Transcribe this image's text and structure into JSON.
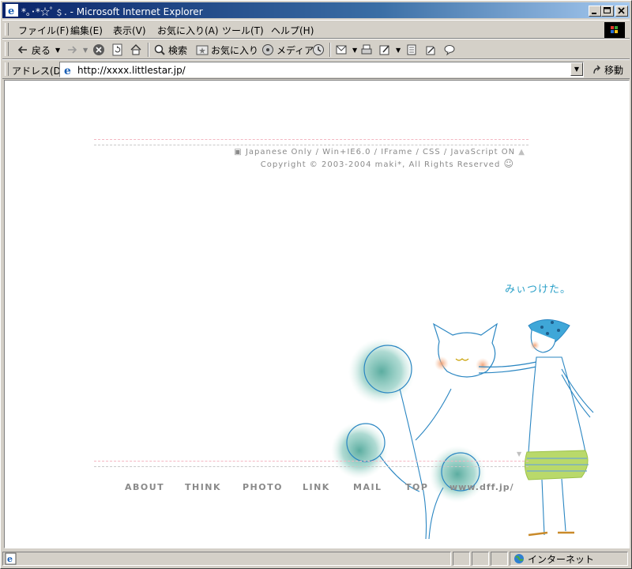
{
  "window": {
    "title": "*｡･*☆ﾟ﹩. - Microsoft Internet Explorer"
  },
  "menu": [
    "ファイル(F)",
    "編集(E)",
    "表示(V)",
    "お気に入り(A)",
    "ツール(T)",
    "ヘルプ(H)"
  ],
  "toolbar": {
    "back": "戻る",
    "search": "検索",
    "favorites": "お気に入り",
    "media": "メディア"
  },
  "address": {
    "label": "アドレス(D)",
    "url": "http://xxxx.littlestar.jp/",
    "go": "移動"
  },
  "page": {
    "info_line": "Japanese Only / Win+IE6.0 / IFrame / CSS / JavaScript ON",
    "copyright": "Copyright © 2003-2004 maki*, All Rights Reserved",
    "handwriting": "みぃつけた。",
    "nav": [
      "ABOUT",
      "THINK",
      "PHOTO",
      "LINK",
      "MAIL",
      "TOP",
      "www.dff.jp/"
    ]
  },
  "status": {
    "zone": "インターネット"
  },
  "colors": {
    "title_start": "#0a246a",
    "title_end": "#a6caf0",
    "dash_pink": "#f4b6c2",
    "dash_gray": "#c0c0c0",
    "nav": "#8a8a8a",
    "accent_blue": "#2aa0c8"
  }
}
